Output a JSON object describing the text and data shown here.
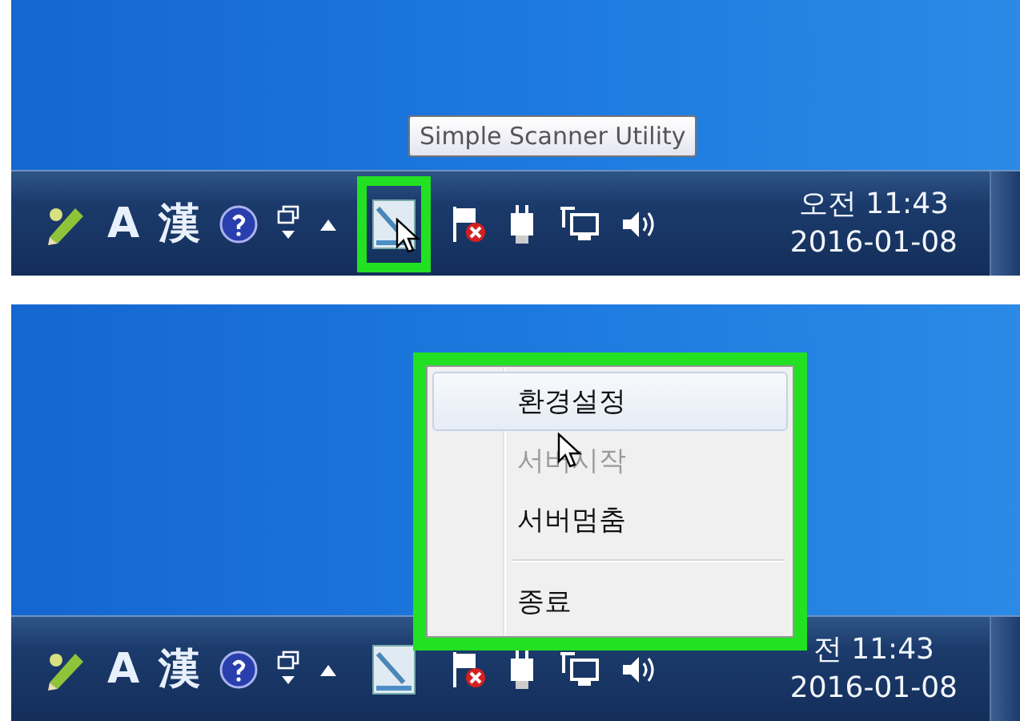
{
  "panels": [
    {
      "kind": "tooltip",
      "tooltip": "Simple Scanner Utility",
      "taskbar": {
        "ime": [
          "A",
          "漢"
        ],
        "app_icon_highlighted": true,
        "clock": {
          "time": "오전 11:43",
          "date": "2016-01-08"
        }
      }
    },
    {
      "kind": "menu",
      "menu": {
        "highlighted": true,
        "items": [
          {
            "kind": "item",
            "label": "환경설정",
            "selected": true,
            "disabled": false
          },
          {
            "kind": "item",
            "label": "서버시작",
            "selected": false,
            "disabled": true
          },
          {
            "kind": "item",
            "label": "서버멈춤",
            "selected": false,
            "disabled": false
          },
          {
            "kind": "separator"
          },
          {
            "kind": "item",
            "label": "종료",
            "selected": false,
            "disabled": false
          }
        ]
      },
      "taskbar": {
        "ime": [
          "A",
          "漢"
        ],
        "app_icon_highlighted": false,
        "clock": {
          "time": "전 11:43",
          "date": "2016-01-08"
        }
      }
    }
  ]
}
